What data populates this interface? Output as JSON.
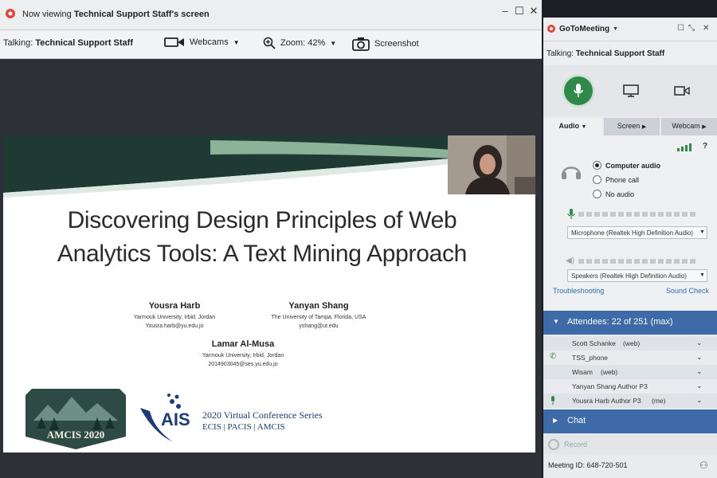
{
  "viewer": {
    "window_title_prefix": "Now viewing ",
    "window_title_name": "Technical Support Staff's screen",
    "talking_label": "Talking:",
    "talking_name": "Technical Support Staff",
    "webcams_label": "Webcams",
    "zoom_label": "Zoom: 42%",
    "screenshot_label": "Screenshot"
  },
  "slide": {
    "title": "Discovering Design Principles of Web Analytics Tools: A Text Mining Approach",
    "authors": [
      {
        "name": "Yousra Harb",
        "affiliation": "Yarmouk University, Irbid, Jordan",
        "email": "Yousra.harb@yu.edu.jo"
      },
      {
        "name": "Yanyan Shang",
        "affiliation": "The University of Tampa, Florida, USA",
        "email": "yshang@ut.edu"
      },
      {
        "name": "Lamar Al-Musa",
        "affiliation": "Yarmouk University, Irbid, Jordan",
        "email": "2014903045@ses.yu.edu.jo"
      }
    ],
    "amcis_text": "AMCIS 2020",
    "ais_text": "AIS",
    "ais_series": "2020 Virtual Conference Series",
    "ais_confs": "ECIS | PACIS | AMCIS"
  },
  "panel": {
    "app_name": "GoToMeeting",
    "talking_label": "Talking:",
    "talking_name": "Technical Support Staff",
    "tabs": [
      "Audio",
      "Screen",
      "Webcam"
    ],
    "audio_options": [
      "Computer audio",
      "Phone call",
      "No audio"
    ],
    "selected_audio": "Computer audio",
    "microphone": "Microphone (Realtek High Definition Audio)",
    "speakers": "Speakers (Realtek High Definition Audio)",
    "troubleshooting": "Troubleshooting",
    "sound_check": "Sound Check",
    "help": "?",
    "attendees_label": "Attendees: 22 of 251 (max)",
    "attendees": [
      {
        "name": "Scott Schanke",
        "note": "(web)"
      },
      {
        "name": "TSS_phone",
        "note": ""
      },
      {
        "name": "Wisam",
        "note": "(web)"
      },
      {
        "name": "Yanyan Shang Author P3",
        "note": ""
      },
      {
        "name": "Yousra Harb Author P3",
        "note": "(me)"
      }
    ],
    "chat_label": "Chat",
    "record_label": "Record",
    "meeting_id": "Meeting ID: 648-720-501"
  },
  "colors": {
    "accent_blue": "#3e6aa8",
    "mic_green": "#2f8a4a",
    "slide_green": "#2f5a4a"
  }
}
